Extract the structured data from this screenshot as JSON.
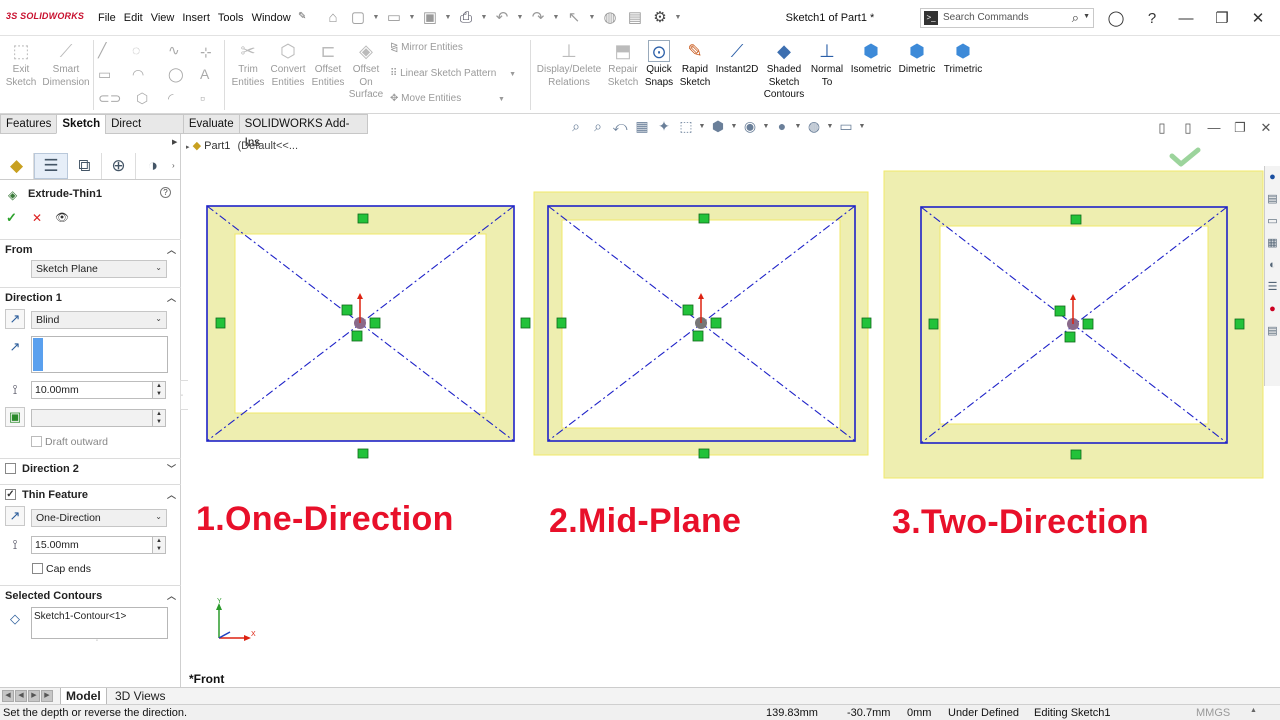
{
  "titlebar": {
    "logo_brand": "SOLIDWORKS",
    "menu": [
      "File",
      "Edit",
      "View",
      "Insert",
      "Tools",
      "Window"
    ],
    "document_title": "Sketch1 of Part1 *",
    "search_placeholder": "Search Commands"
  },
  "ribbon": {
    "exit_sketch": [
      "Exit",
      "Sketch"
    ],
    "smart_dimension": [
      "Smart",
      "Dimension"
    ],
    "trim_entities": [
      "Trim",
      "Entities"
    ],
    "convert_entities": [
      "Convert",
      "Entities"
    ],
    "offset_entities": [
      "Offset",
      "Entities"
    ],
    "offset_on_surface": [
      "Offset",
      "On",
      "Surface"
    ],
    "mirror_entities": "Mirror Entities",
    "linear_sketch_pattern": "Linear Sketch Pattern",
    "move_entities": "Move Entities",
    "display_delete_relations": [
      "Display/Delete",
      "Relations"
    ],
    "repair_sketch": [
      "Repair",
      "Sketch"
    ],
    "quick_snaps": [
      "Quick",
      "Snaps"
    ],
    "rapid_sketch": [
      "Rapid",
      "Sketch"
    ],
    "instant2d": "Instant2D",
    "shaded_sketch_contours": [
      "Shaded",
      "Sketch",
      "Contours"
    ],
    "normal_to": [
      "Normal",
      "To"
    ],
    "isometric": "Isometric",
    "dimetric": "Dimetric",
    "trimetric": "Trimetric"
  },
  "tabs": [
    "Features",
    "Sketch",
    "Direct Editing",
    "Evaluate",
    "SOLIDWORKS Add-Ins"
  ],
  "active_tab": "Sketch",
  "feature_tree": {
    "part": "Part1",
    "config": "(Default<<..."
  },
  "property_manager": {
    "title": "Extrude-Thin1",
    "help": "?",
    "from": {
      "label": "From",
      "value": "Sketch Plane"
    },
    "direction1": {
      "label": "Direction 1",
      "end_condition": "Blind",
      "depth": "10.00mm",
      "draft_outward": "Draft outward"
    },
    "direction2": {
      "label": "Direction 2",
      "checked": false
    },
    "thin_feature": {
      "label": "Thin Feature",
      "checked": true,
      "type": "One-Direction",
      "thickness": "15.00mm",
      "cap_ends": "Cap ends"
    },
    "selected_contours": {
      "label": "Selected Contours",
      "value": "Sketch1-Contour<1>"
    }
  },
  "canvas": {
    "labels": [
      "1.One-Direction",
      "2.Mid-Plane",
      "3.Two-Direction"
    ],
    "label_color": "#e8102a",
    "thin_fill_color": "#eeeeb0",
    "sketch_line_color": "#1e22c8",
    "relation_marker_color": "#22c23a",
    "view_name": "*Front",
    "axis_y": "Y",
    "axis_x": "X"
  },
  "bottom_tabs": [
    "Model",
    "3D Views"
  ],
  "active_bottom_tab": "Model",
  "status": {
    "message": "Set the depth or reverse the direction.",
    "x": "139.83mm",
    "y": "-30.7mm",
    "z": "0mm",
    "definition": "Under Defined",
    "editing": "Editing Sketch1",
    "units": "MMGS"
  }
}
